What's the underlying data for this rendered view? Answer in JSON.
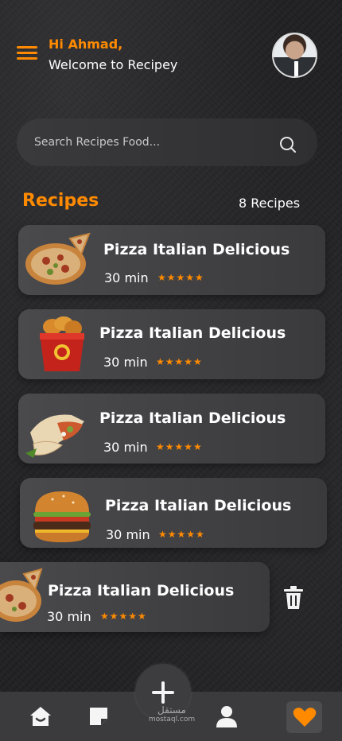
{
  "header": {
    "greeting": "Hi Ahmad,",
    "welcome": "Welcome to Recipey"
  },
  "search": {
    "placeholder": "Search Recipes Food..."
  },
  "recipes_section": {
    "title": "Recipes",
    "count": "8 Recipes"
  },
  "recipes": [
    {
      "title": "Pizza Italian Delicious",
      "time": "30 min",
      "rating": 5,
      "stars": "★★★★★",
      "image": "pizza"
    },
    {
      "title": "Pizza Italian Delicious",
      "time": "30 min",
      "rating": 5,
      "stars": "★★★★★",
      "image": "fried-chicken-bucket"
    },
    {
      "title": "Pizza Italian Delicious",
      "time": "30 min",
      "rating": 5,
      "stars": "★★★★★",
      "image": "wrap"
    },
    {
      "title": "Pizza Italian Delicious",
      "time": "30 min",
      "rating": 5,
      "stars": "★★★★★",
      "image": "burger"
    },
    {
      "title": "Pizza Italian Delicious",
      "time": "30 min",
      "rating": 5,
      "stars": "★★★★★",
      "image": "pizza"
    }
  ],
  "bottom_nav": {
    "items": [
      "home-icon",
      "notes-icon",
      "add-icon",
      "profile-icon",
      "heart-icon"
    ],
    "active": "heart-icon"
  },
  "watermark": {
    "arabic": "مستقل",
    "url": "mostaql.com"
  },
  "colors": {
    "accent": "#ff8a00",
    "card": "#444447",
    "nav": "#3b3b3e"
  }
}
